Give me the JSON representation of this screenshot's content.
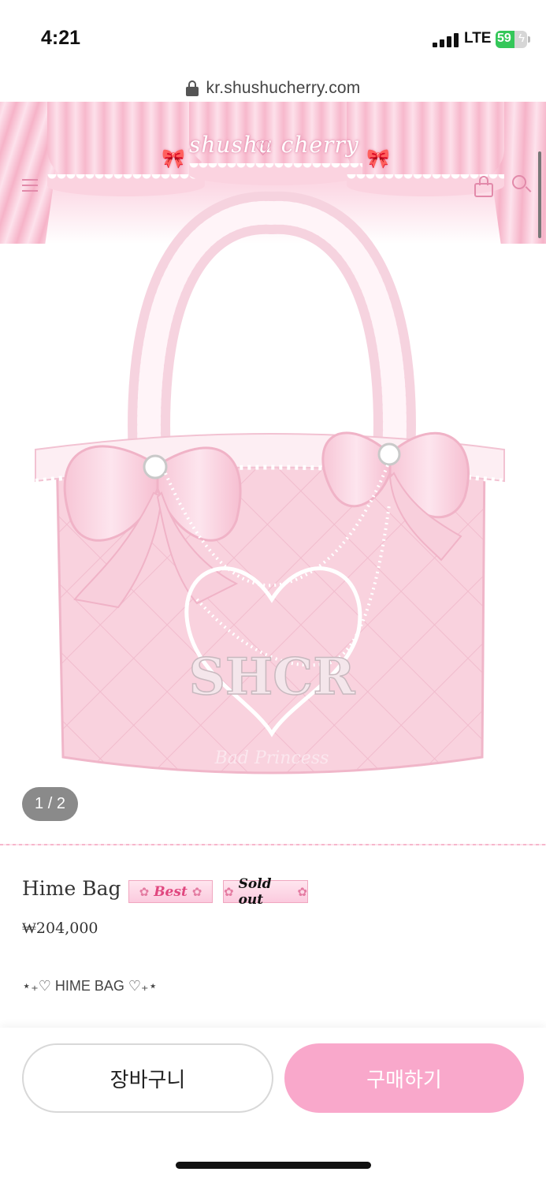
{
  "status_bar": {
    "time": "4:21",
    "network": "LTE",
    "battery": "59",
    "battery_level": 0.59,
    "battery_color": "#34c759"
  },
  "browser": {
    "url": "kr.shushucherry.com"
  },
  "header": {
    "logo_text": "shushu cherry",
    "accent_color": "#e28aaa",
    "icons": [
      "menu-icon",
      "shopping-bag-icon",
      "search-icon"
    ]
  },
  "product": {
    "image_description_icon": "pink-quilted-tote-bag-image",
    "image_counter": "1 / 2",
    "name": "Hime Bag",
    "badges": {
      "best": "Best",
      "sold_out": "Sold out"
    },
    "price": "₩204,000",
    "description": "⋆₊♡ HIME BAG ♡₊⋆"
  },
  "actions": {
    "cart_label": "장바구니",
    "buy_label": "구매하기",
    "buy_color": "#f9a8cb"
  }
}
